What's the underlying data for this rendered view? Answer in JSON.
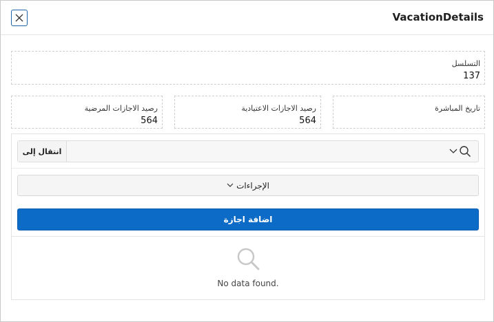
{
  "dialog": {
    "title": "VacationDetails",
    "close_icon": "close-icon"
  },
  "fields": {
    "serial": {
      "label": "التسلسل",
      "value": "137"
    },
    "start_date": {
      "label": "تاريخ المباشرة",
      "value": ""
    },
    "regular_balance": {
      "label": "رصيد الاجازات الاعتيادية",
      "value": "564"
    },
    "sick_balance": {
      "label": "رصيد الاجازات المرضية",
      "value": "564"
    }
  },
  "report": {
    "go_label": "انتقال إلى",
    "search_value": "",
    "search_icon": "search-icon",
    "actions_label": "الإجراءات",
    "add_label": "اضافة اجازة",
    "empty_text": "No data found."
  },
  "colors": {
    "primary": "#0c6bc7",
    "close_border": "#1a63a8"
  }
}
